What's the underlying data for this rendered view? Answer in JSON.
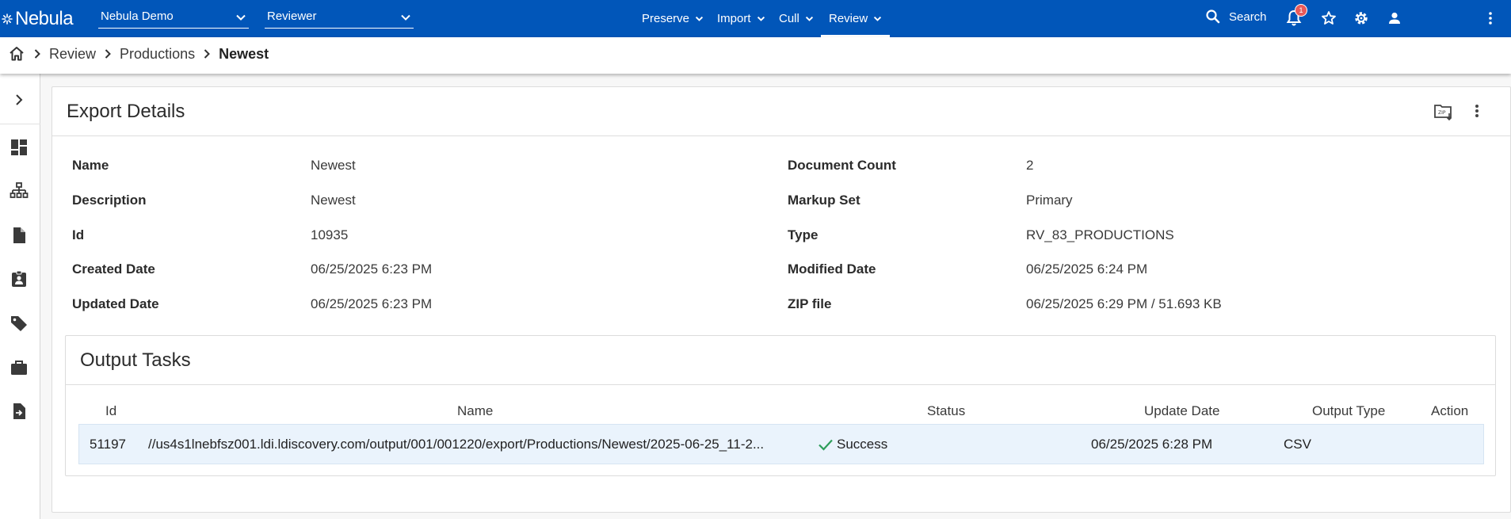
{
  "topbar": {
    "logo_text": "Nebula",
    "project_select": "Nebula Demo",
    "role_select": "Reviewer",
    "nav": [
      {
        "label": "Preserve"
      },
      {
        "label": "Import"
      },
      {
        "label": "Cull"
      },
      {
        "label": "Review"
      }
    ],
    "search_label": "Search",
    "notification_count": "1",
    "icons": [
      "search-icon",
      "bell-icon",
      "star-icon",
      "gear-icon",
      "user-icon",
      "more-vertical-icon"
    ]
  },
  "breadcrumb": {
    "items": [
      "Review",
      "Productions"
    ],
    "current": "Newest"
  },
  "sidebar": {
    "icons": [
      "chevron-right-icon",
      "dashboard-icon",
      "hierarchy-icon",
      "document-icon",
      "assignment-icon",
      "tag-icon",
      "briefcase-icon",
      "export-icon"
    ]
  },
  "export": {
    "title": "Export Details",
    "left_fields": [
      {
        "label": "Name",
        "value": "Newest"
      },
      {
        "label": "Description",
        "value": "Newest"
      },
      {
        "label": "Id",
        "value": "10935"
      },
      {
        "label": "Created Date",
        "value": "06/25/2025 6:23 PM"
      },
      {
        "label": "Updated Date",
        "value": "06/25/2025 6:23 PM"
      }
    ],
    "right_fields": [
      {
        "label": "Document Count",
        "value": "2"
      },
      {
        "label": "Markup Set",
        "value": "Primary"
      },
      {
        "label": "Type",
        "value": "RV_83_PRODUCTIONS"
      },
      {
        "label": "Modified Date",
        "value": "06/25/2025 6:24 PM"
      },
      {
        "label": "ZIP file",
        "value": "06/25/2025 6:29 PM / 51.693 KB"
      }
    ]
  },
  "tasks": {
    "title": "Output Tasks",
    "columns": [
      "Id",
      "Name",
      "Status",
      "Update Date",
      "Output Type",
      "Action"
    ],
    "rows": [
      {
        "id": "51197",
        "name": "//us4s1lnebfsz001.ldi.ldiscovery.com/output/001/001220/export/Productions/Newest/2025-06-25_11-2...",
        "status": "Success",
        "update_date": "06/25/2025 6:28 PM",
        "output_type": "CSV",
        "action": ""
      }
    ]
  },
  "colors": {
    "brand": "#0156b9",
    "success": "#2e9e5b",
    "row_highlight": "#eaf3fc",
    "badge": "#e85a5a"
  }
}
